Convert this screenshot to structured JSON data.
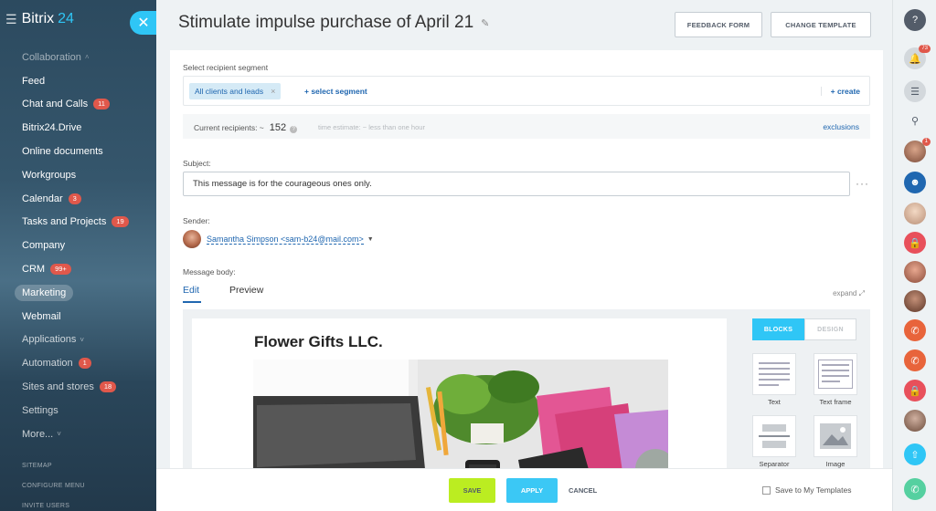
{
  "brand": {
    "name": "Bitrix",
    "number": "24"
  },
  "sidebar": {
    "items": [
      {
        "label": "Collaboration",
        "type": "section",
        "chevron": "chevron-up-icon"
      },
      {
        "label": "Feed"
      },
      {
        "label": "Chat and Calls",
        "badge": "11"
      },
      {
        "label": "Bitrix24.Drive"
      },
      {
        "label": "Online documents"
      },
      {
        "label": "Workgroups"
      },
      {
        "label": "Calendar",
        "badge": "3"
      },
      {
        "label": "Tasks and Projects",
        "badge": "19"
      },
      {
        "label": "Company"
      },
      {
        "label": "CRM",
        "badge": "99+"
      },
      {
        "label": "Marketing",
        "active": true
      },
      {
        "label": "Webmail"
      },
      {
        "label": "Applications",
        "type": "dim",
        "chevron": "chevron-down-icon"
      },
      {
        "label": "Automation",
        "badge": "1",
        "type": "dim"
      },
      {
        "label": "Sites and stores",
        "badge": "18",
        "type": "dim"
      },
      {
        "label": "Settings",
        "type": "dim"
      },
      {
        "label": "More...",
        "type": "dim",
        "chevron": "chevron-down-icon"
      }
    ],
    "footer": [
      "SITEMAP",
      "CONFIGURE MENU",
      "INVITE USERS"
    ]
  },
  "header": {
    "title": "Stimulate impulse purchase of April 21",
    "feedback_label": "FEEDBACK FORM",
    "change_template_label": "CHANGE TEMPLATE"
  },
  "segment": {
    "label": "Select recipient segment",
    "chip": "All clients and leads",
    "add_label": "+ select segment",
    "create_label": "+ create"
  },
  "recipients": {
    "label": "Current recipients: ~",
    "count": "152",
    "time_estimate": "time estimate: ~ less than one hour",
    "exclusions_label": "exclusions"
  },
  "subject": {
    "label": "Subject:",
    "value": "This message is for the courageous ones only."
  },
  "sender": {
    "label": "Sender:",
    "value": "Samantha Simpson <sam-b24@mail.com>"
  },
  "body": {
    "label": "Message body:",
    "tabs": [
      "Edit",
      "Preview"
    ],
    "expand_label": "expand",
    "canvas_title": "Flower Gifts LLC.",
    "panel_tabs": [
      "BLOCKS",
      "DESIGN"
    ],
    "blocks": [
      "Text",
      "Text frame",
      "Separator",
      "Image"
    ]
  },
  "footer_bar": {
    "save_label": "SAVE",
    "apply_label": "APPLY",
    "cancel_label": "CANCEL",
    "save_template_label": "Save to My Templates"
  },
  "right_rail": {
    "notifications_badge": "73",
    "user_badge": "1"
  },
  "colors": {
    "accent": "#2fc6f6",
    "save": "#bbed21",
    "link": "#2067b0",
    "badge": "#e0584b"
  }
}
